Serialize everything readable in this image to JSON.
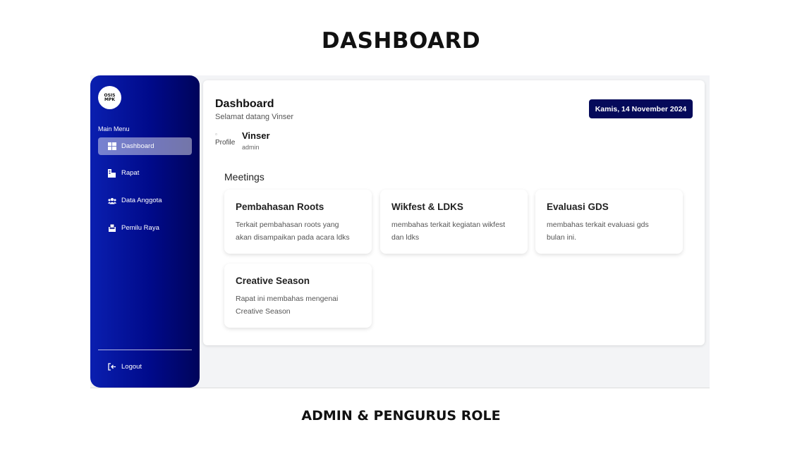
{
  "headings": {
    "top": "DASHBOARD",
    "bottom": "ADMIN & PENGURUS ROLE"
  },
  "sidebar": {
    "logo_text": "OSIS MPK",
    "menu_title": "Main Menu",
    "items": [
      {
        "label": "Dashboard",
        "icon": "grid-icon",
        "active": true
      },
      {
        "label": "Rapat",
        "icon": "building-icon",
        "active": false
      },
      {
        "label": "Data Anggota",
        "icon": "users-icon",
        "active": false
      },
      {
        "label": "Pemilu Raya",
        "icon": "vote-icon",
        "active": false
      }
    ],
    "logout_label": "Logout",
    "colors": {
      "gradient_start": "#0a1fb0",
      "gradient_end": "#00045a"
    }
  },
  "header": {
    "title": "Dashboard",
    "welcome": "Selamat datang Vinser",
    "date": "Kamis, 14 November 2024",
    "date_badge_color": "#050a5a"
  },
  "user": {
    "avatar_alt": "Profile",
    "name": "Vinser",
    "role": "admin"
  },
  "meetings": {
    "title": "Meetings",
    "cards": [
      {
        "title": "Pembahasan Roots",
        "desc_line1": "Terkait pembahasan roots yang",
        "desc_line2": "akan disampaikan pada acara ldks"
      },
      {
        "title": "Wikfest & LDKS",
        "desc_line1": "membahas terkait kegiatan wikfest",
        "desc_line2": "dan ldks"
      },
      {
        "title": "Evaluasi GDS",
        "desc_line1": "membahas terkait evaluasi gds",
        "desc_line2": "bulan ini."
      },
      {
        "title": "Creative Season",
        "desc_line1": "Rapat ini membahas mengenai",
        "desc_line2": "Creative Season"
      }
    ]
  }
}
